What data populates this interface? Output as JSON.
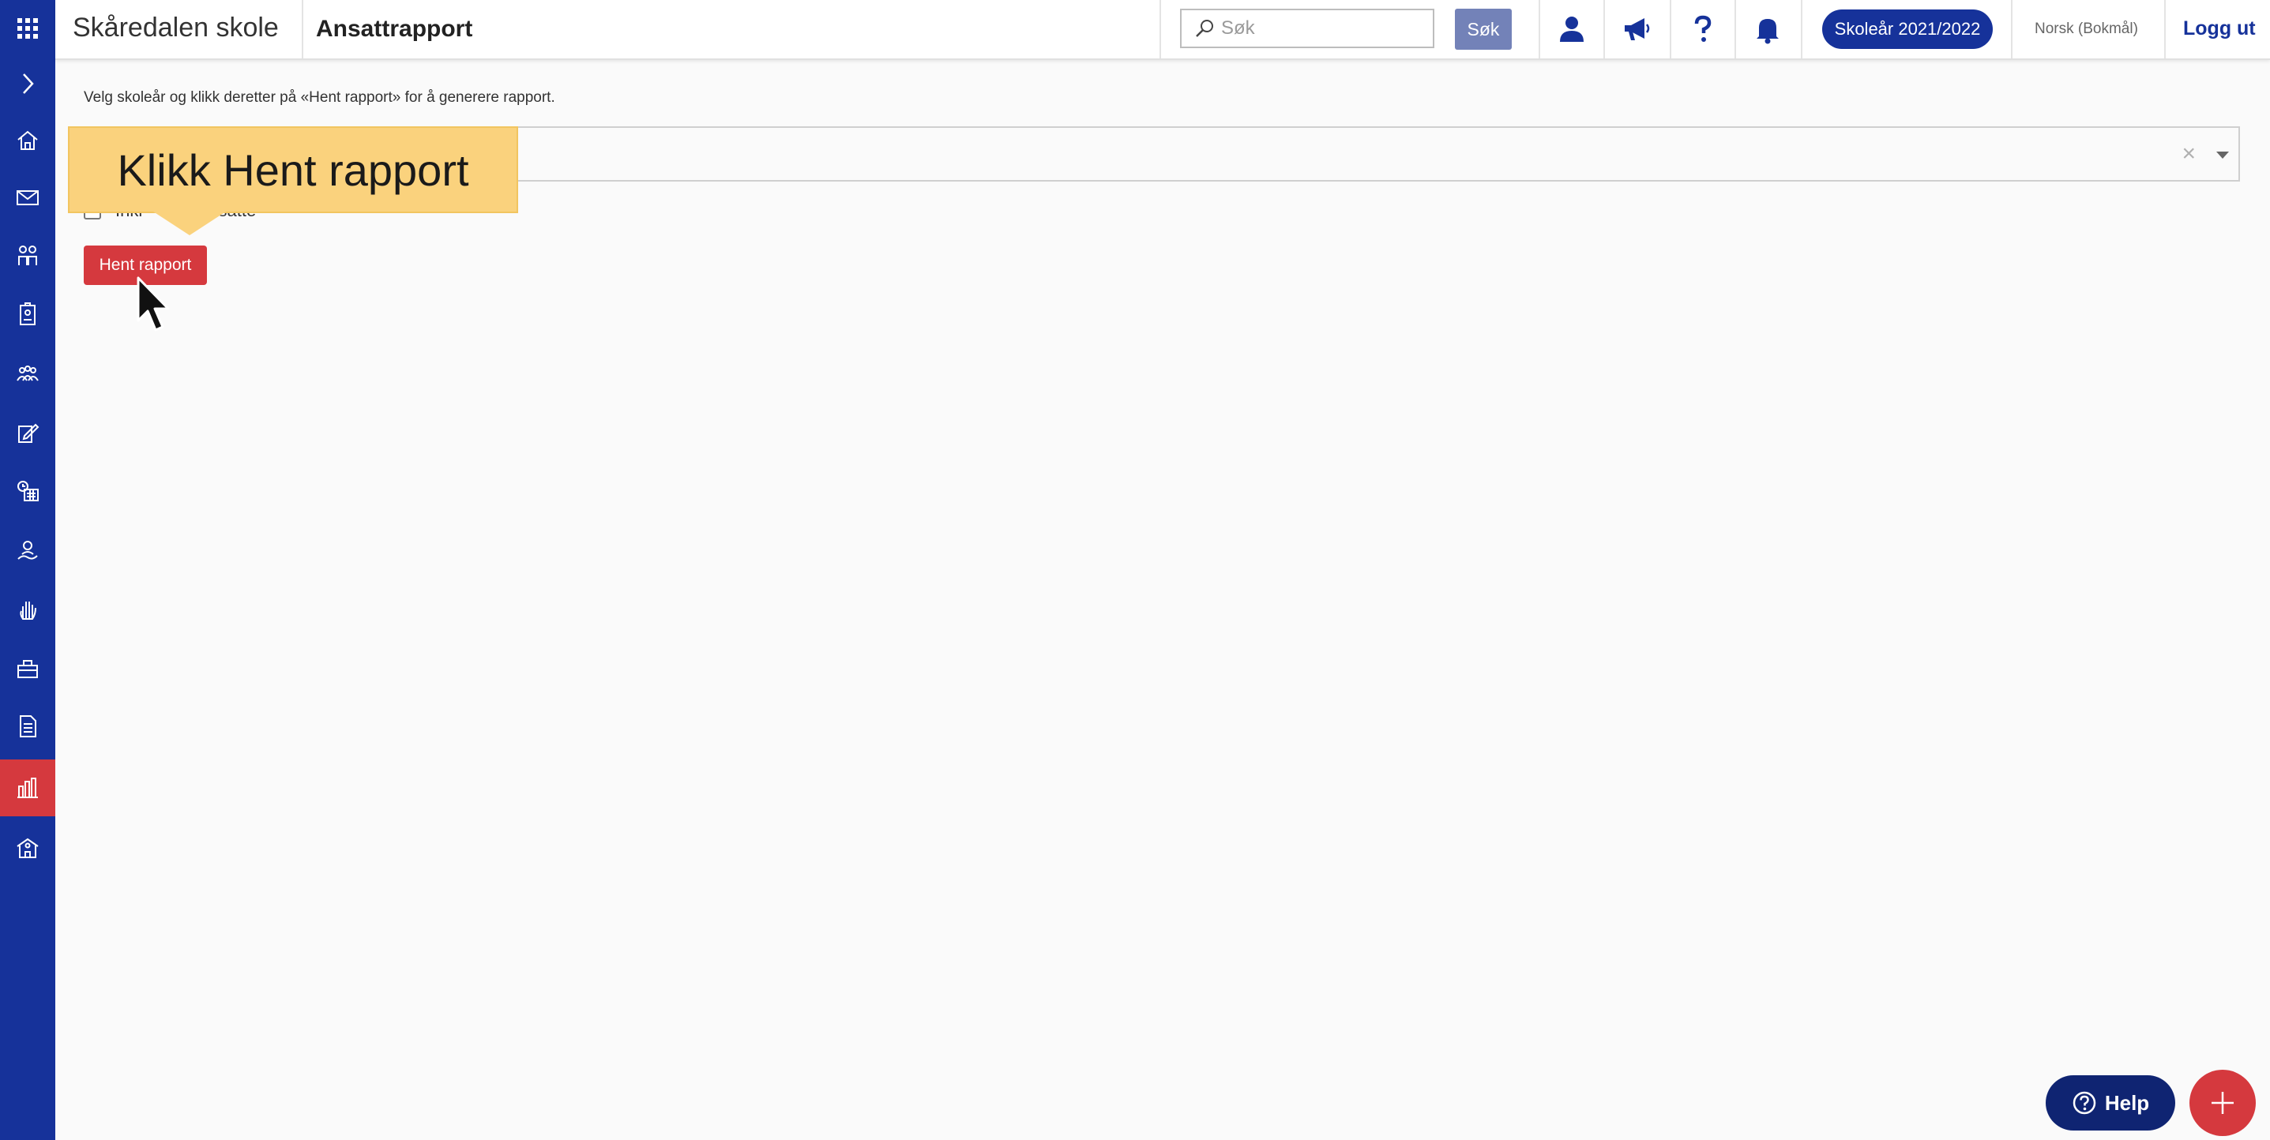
{
  "app": {
    "school_name": "Skåredalen skole",
    "page_title": "Ansattrapport"
  },
  "search": {
    "placeholder": "Søk",
    "button_label": "Søk"
  },
  "header": {
    "school_year": "Skoleår 2021/2022",
    "language": "Norsk (Bokmål)",
    "logout": "Logg ut"
  },
  "main": {
    "instruction": "Velg skoleår og klikk deretter på «Hent rapport» for å generere rapport.",
    "select_clear": "×",
    "checkbox_label_left": "Inkl",
    "checkbox_label_right": "nsatte",
    "report_button": "Hent rapport"
  },
  "tooltip": {
    "text": "Klikk Hent rapport"
  },
  "floating": {
    "help_label": "Help"
  },
  "sidebar": {
    "items": [
      {
        "icon": "apps-grid-icon"
      },
      {
        "icon": "chevron-right-icon"
      },
      {
        "icon": "home-icon"
      },
      {
        "icon": "mail-icon"
      },
      {
        "icon": "people-icon"
      },
      {
        "icon": "id-badge-icon"
      },
      {
        "icon": "group-icon"
      },
      {
        "icon": "edit-document-icon"
      },
      {
        "icon": "schedule-icon"
      },
      {
        "icon": "person-hand-icon"
      },
      {
        "icon": "hand-raise-icon"
      },
      {
        "icon": "toolbox-icon"
      },
      {
        "icon": "document-icon"
      },
      {
        "icon": "bar-chart-icon",
        "active": true
      },
      {
        "icon": "school-building-icon"
      }
    ]
  },
  "colors": {
    "sidebar": "#16329a",
    "accent_red": "#d5393e",
    "tooltip": "#fad27d",
    "search_button": "#7382b8"
  }
}
